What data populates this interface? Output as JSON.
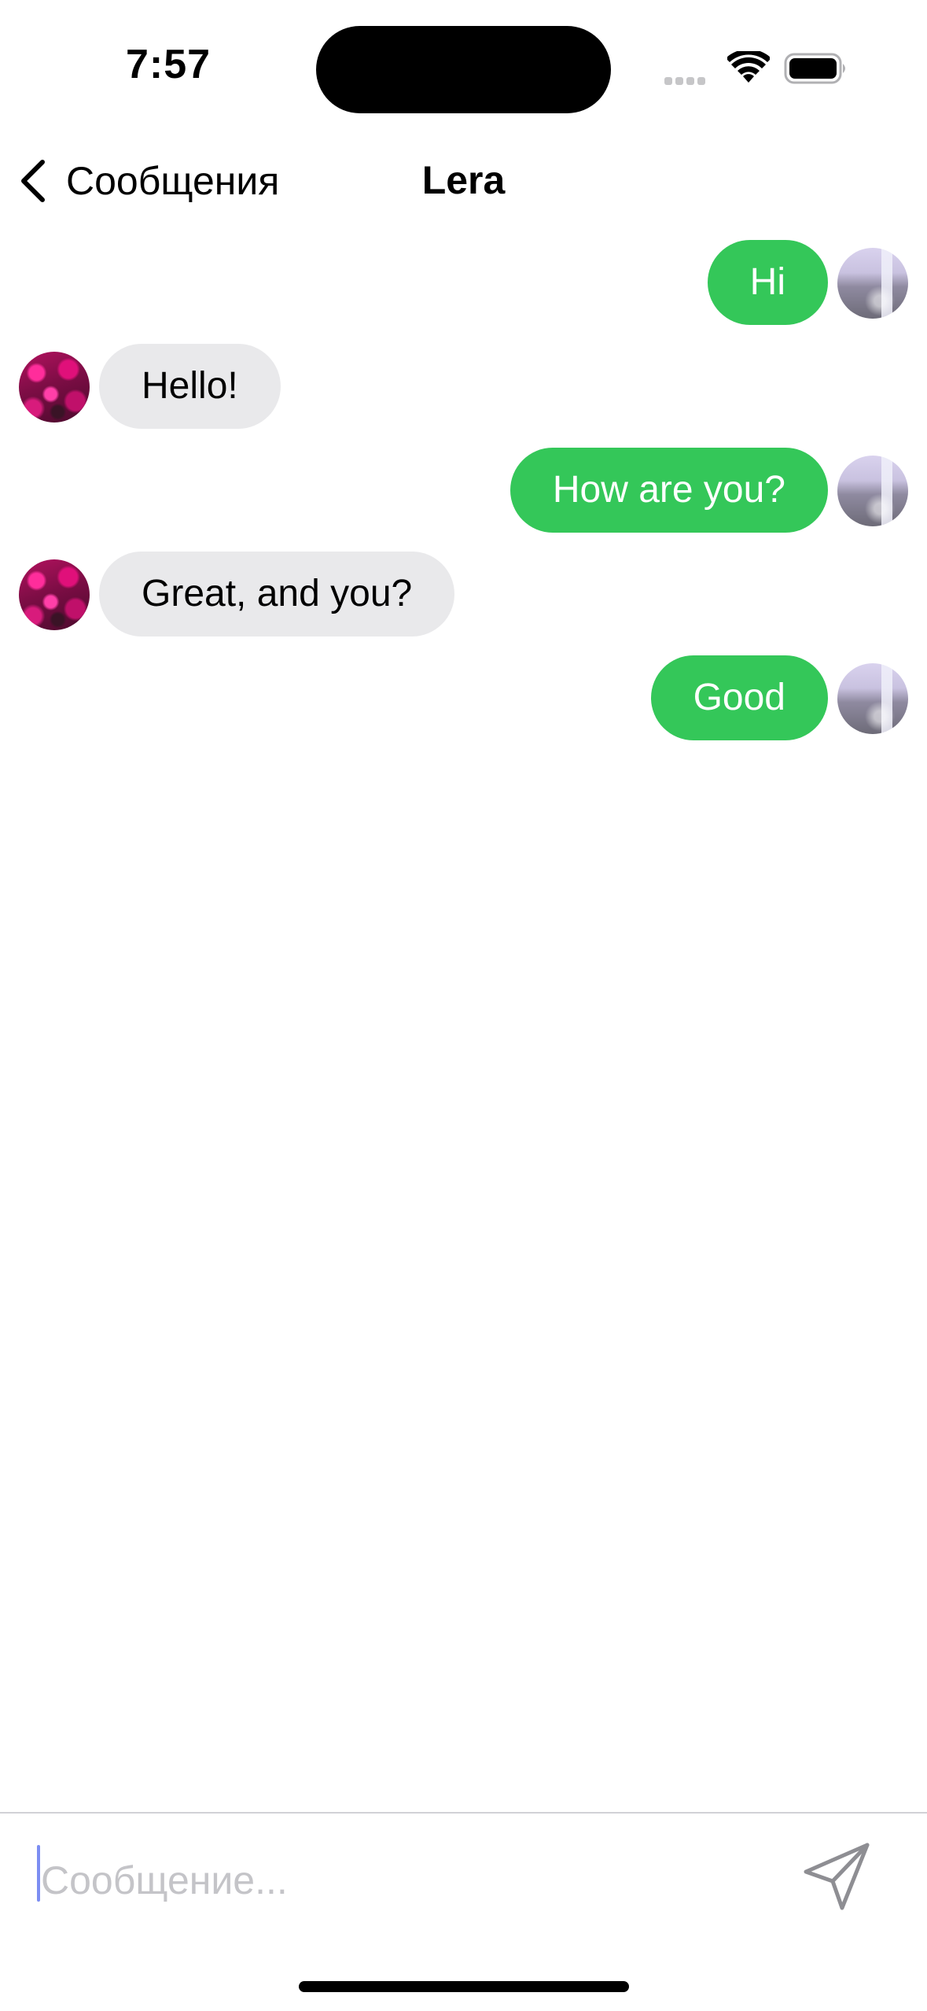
{
  "status_bar": {
    "time": "7:57",
    "icons": [
      "cellular-signal-icon",
      "wifi-icon",
      "battery-icon"
    ]
  },
  "nav": {
    "back_label": "Сообщения",
    "title": "Lera"
  },
  "colors": {
    "outgoing_bubble": "#34c759",
    "incoming_bubble": "#e9e9eb",
    "outgoing_text": "#ffffff",
    "incoming_text": "#000000"
  },
  "messages": [
    {
      "direction": "outgoing",
      "text": "Hi"
    },
    {
      "direction": "incoming",
      "text": "Hello!"
    },
    {
      "direction": "outgoing",
      "text": "How are you?"
    },
    {
      "direction": "incoming",
      "text": "Great, and you?"
    },
    {
      "direction": "outgoing",
      "text": "Good"
    }
  ],
  "composer": {
    "value": "",
    "placeholder": "Сообщение...",
    "send_icon": "send-icon"
  }
}
